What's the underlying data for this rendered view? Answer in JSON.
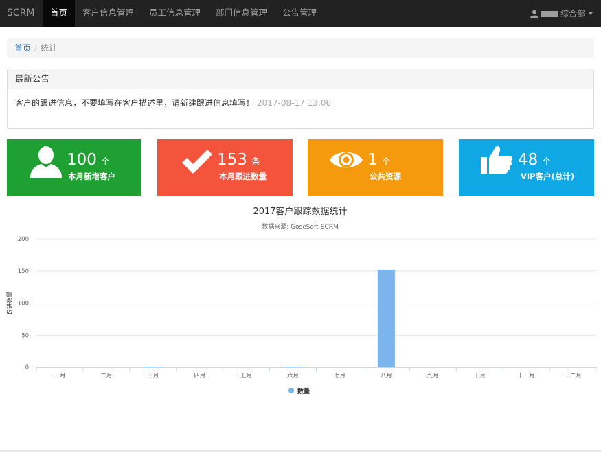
{
  "navbar": {
    "brand": "SCRM",
    "items": [
      {
        "label": "首页",
        "active": true
      },
      {
        "label": "客户信息管理"
      },
      {
        "label": "员工信息管理"
      },
      {
        "label": "部门信息管理"
      },
      {
        "label": "公告管理"
      }
    ],
    "user_label": "综合部"
  },
  "breadcrumb": {
    "home": "首页",
    "separator": "/",
    "current": "统计"
  },
  "notice": {
    "heading": "最新公告",
    "text": "客户的跟进信息，不要填写在客户描述里，请新建跟进信息填写！",
    "date": "2017-08-17 13:06"
  },
  "tiles": [
    {
      "value": "100",
      "unit": "个",
      "label": "本月新增客户",
      "color": "#1fa032",
      "icon": "user-icon"
    },
    {
      "value": "153",
      "unit": "条",
      "label": "本月跟进数量",
      "color": "#f5543c",
      "icon": "check-icon"
    },
    {
      "value": "1",
      "unit": "个",
      "label": "公共资源",
      "color": "#f59a0c",
      "icon": "eye-icon"
    },
    {
      "value": "48",
      "unit": "个",
      "label": "VIP客户(总计)",
      "color": "#10a8e4",
      "icon": "thumbs-up-icon"
    }
  ],
  "chart_data": {
    "type": "bar",
    "title": "2017客户跟踪数据统计",
    "subtitle": "数据来源: GoseSoft-SCRM",
    "ylabel": "跟进数量",
    "xlabel": "",
    "categories": [
      "一月",
      "二月",
      "三月",
      "四月",
      "五月",
      "六月",
      "七月",
      "八月",
      "九月",
      "十月",
      "十一月",
      "十二月"
    ],
    "series": [
      {
        "name": "数量",
        "values": [
          0,
          0,
          1,
          0,
          0,
          1,
          0,
          152,
          0,
          0,
          0,
          0
        ],
        "color": "#7cb5ec"
      }
    ],
    "ylim": [
      0,
      200
    ],
    "yticks": [
      0,
      50,
      100,
      150,
      200
    ],
    "grid": true,
    "legend": "bottom-center"
  }
}
